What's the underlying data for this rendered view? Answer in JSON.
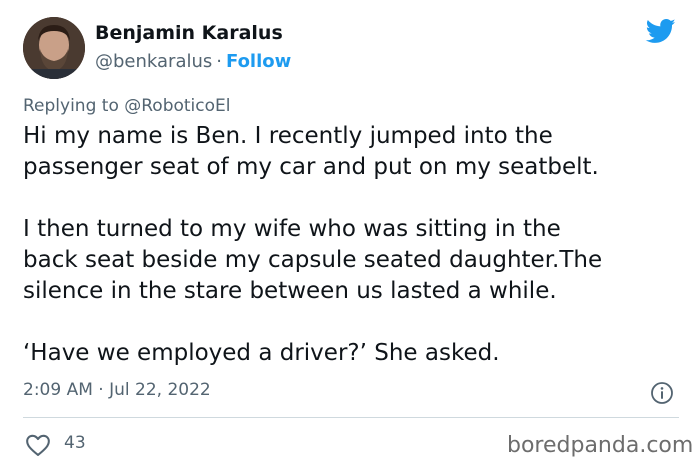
{
  "author": {
    "name": "Benjamin Karalus",
    "handle": "@benkaralus",
    "separator": "·",
    "follow_label": "Follow"
  },
  "reply": {
    "prefix": "Replying to",
    "mention": "@RoboticoEl"
  },
  "tweet": {
    "lines": [
      "Hi my name is Ben. I recently jumped into the",
      "passenger seat of my car and put on my seatbelt.",
      "",
      "I then turned to my wife who was sitting in the",
      "back seat beside my capsule seated daughter.The",
      "silence in the stare between us lasted a while.",
      "",
      "‘Have we employed a driver?’ She asked."
    ],
    "timestamp": "2:09 AM · Jul 22, 2022"
  },
  "engagement": {
    "likes": "43"
  },
  "watermark": "boredpanda.com",
  "icons": {
    "brand": "twitter-bird-icon",
    "info": "info-icon",
    "like": "heart-icon"
  },
  "colors": {
    "accent": "#1d9bf0",
    "text": "#0f1419",
    "muted": "#536471",
    "divider": "#cfd9de"
  }
}
